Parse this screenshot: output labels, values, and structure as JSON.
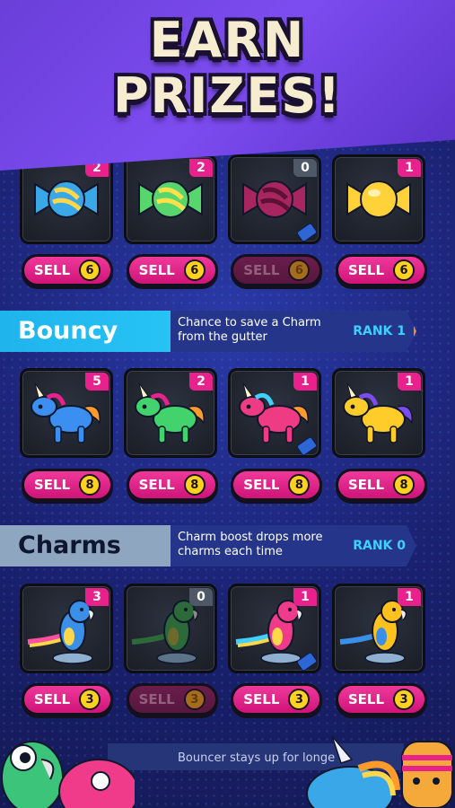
{
  "header": {
    "title": "EARN\nPRIZES!"
  },
  "rows": [
    {
      "id": "candy",
      "items": [
        {
          "count": "2",
          "color": "#3aa7e8",
          "stripe": "#ffd74a",
          "sell": "SELL",
          "price": "6",
          "enabled": true
        },
        {
          "count": "2",
          "color": "#57d66d",
          "stripe": "#ffe04a",
          "sell": "SELL",
          "price": "6",
          "enabled": true
        },
        {
          "count": "0",
          "color": "#a8265f",
          "stripe": "#5c1135",
          "sell": "SELL",
          "price": "6",
          "enabled": false
        },
        {
          "count": "1",
          "color": "#ffd23a",
          "stripe": "#ffe98a",
          "sell": "SELL",
          "price": "6",
          "enabled": true
        }
      ]
    },
    {
      "id": "bouncy",
      "banner": {
        "name": "Bouncy",
        "desc": "Chance to save a Charm from the gutter",
        "rank": "RANK 1"
      },
      "items": [
        {
          "count": "5",
          "color": "#3a8ff0",
          "sell": "SELL",
          "price": "8",
          "enabled": true
        },
        {
          "count": "2",
          "color": "#43d36d",
          "sell": "SELL",
          "price": "8",
          "enabled": true
        },
        {
          "count": "1",
          "color": "#ef3b84",
          "sell": "SELL",
          "price": "8",
          "enabled": true
        },
        {
          "count": "1",
          "color": "#ffcc2a",
          "sell": "SELL",
          "price": "8",
          "enabled": true
        }
      ]
    },
    {
      "id": "charms",
      "banner": {
        "name": "Charms",
        "desc": "Charm boost drops more charms each time",
        "rank": "RANK 0"
      },
      "items": [
        {
          "count": "3",
          "color": "#3a8fe8",
          "sell": "SELL",
          "price": "3",
          "enabled": true
        },
        {
          "count": "0",
          "color": "#2c6a3a",
          "sell": "SELL",
          "price": "3",
          "enabled": false
        },
        {
          "count": "1",
          "color": "#ef3b8a",
          "sell": "SELL",
          "price": "3",
          "enabled": true
        },
        {
          "count": "1",
          "color": "#ffc11e",
          "sell": "SELL",
          "price": "3",
          "enabled": true
        }
      ]
    }
  ],
  "bottom": {
    "desc": "Bouncer stays up for longe"
  },
  "colors": {
    "accent": "#e8218c",
    "coin": "#ffd21e",
    "header": "#6a3fd8",
    "bouncy": "#27c3f5",
    "charms": "#8fa6c0"
  }
}
